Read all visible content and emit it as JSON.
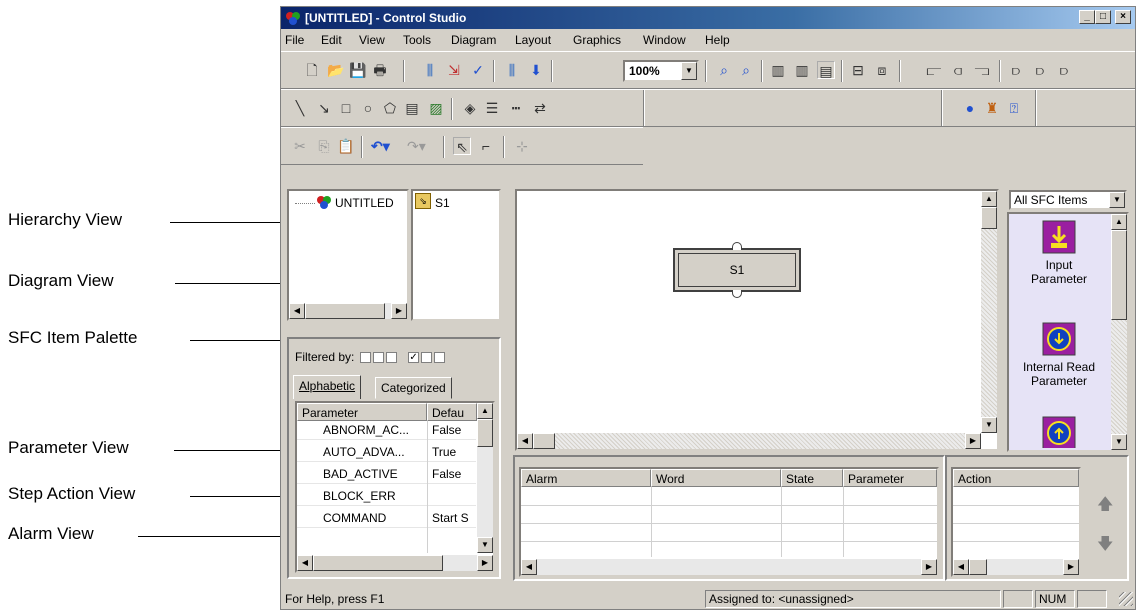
{
  "callouts": {
    "hierarchy": "Hierarchy View",
    "diagram": "Diagram View",
    "palette": "SFC Item Palette",
    "parameter": "Parameter View",
    "step_action": "Step Action View",
    "alarm": "Alarm View"
  },
  "window": {
    "title": "[UNTITLED] - Control Studio"
  },
  "menu": [
    "File",
    "Edit",
    "View",
    "Tools",
    "Diagram",
    "Layout",
    "Graphics",
    "Window",
    "Help"
  ],
  "toolbar": {
    "zoom": "100%"
  },
  "hierarchy": {
    "root": "UNTITLED",
    "step": "S1"
  },
  "diagram": {
    "step_label": "S1"
  },
  "palette": {
    "filter": "All SFC Items",
    "items": [
      {
        "label": "Input Parameter"
      },
      {
        "label": "Internal Read Parameter"
      }
    ]
  },
  "params": {
    "filtered_by": "Filtered by:",
    "tabs": [
      "Alphabetic",
      "Categorized"
    ],
    "columns": [
      "Parameter",
      "Defau"
    ],
    "rows": [
      {
        "name": "ABNORM_AC...",
        "value": "False"
      },
      {
        "name": "AUTO_ADVA...",
        "value": "True"
      },
      {
        "name": "BAD_ACTIVE",
        "value": "False"
      },
      {
        "name": "BLOCK_ERR",
        "value": ""
      },
      {
        "name": "COMMAND",
        "value": "Start S"
      }
    ]
  },
  "alarm": {
    "columns": [
      "Alarm",
      "Word",
      "State",
      "Parameter"
    ]
  },
  "action": {
    "column": "Action"
  },
  "status": {
    "help": "For Help, press F1",
    "assigned": "Assigned to: <unassigned>",
    "num": "NUM"
  }
}
